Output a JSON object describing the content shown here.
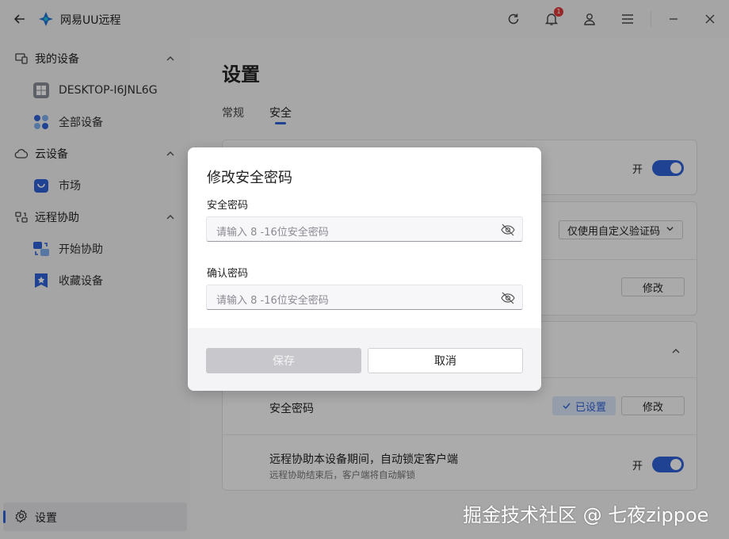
{
  "app": {
    "title": "网易UU远程",
    "notification_count": "1",
    "colors": {
      "accent": "#2e63d8",
      "badge": "#e23a3a"
    }
  },
  "titlebar_icons": [
    "back-icon",
    "refresh-icon",
    "bell-icon",
    "user-icon",
    "menu-icon",
    "minimize-icon",
    "close-icon"
  ],
  "sidebar": {
    "groups": [
      {
        "label": "我的设备",
        "icon": "devices-icon",
        "items": [
          {
            "label": "DESKTOP-I6JNL6G",
            "icon": "windows-icon"
          },
          {
            "label": "全部设备",
            "icon": "all-devices-icon"
          }
        ]
      },
      {
        "label": "云设备",
        "icon": "cloud-icon",
        "items": [
          {
            "label": "市场",
            "icon": "market-icon"
          }
        ]
      },
      {
        "label": "远程协助",
        "icon": "assist-icon",
        "items": [
          {
            "label": "开始协助",
            "icon": "start-assist-icon"
          },
          {
            "label": "收藏设备",
            "icon": "favorite-icon"
          }
        ]
      }
    ],
    "settings_label": "设置"
  },
  "main": {
    "title": "设置",
    "tabs": [
      {
        "label": "常规"
      },
      {
        "label": "安全",
        "active": true
      }
    ],
    "rows": {
      "toggle1": {
        "state_label": "开",
        "on": true
      },
      "verification": {
        "dropdown_value": "仅使用自定义验证码"
      },
      "modify1": {
        "button_label": "修改"
      },
      "security_password": {
        "label": "安全密码",
        "status": "已设置",
        "button_label": "修改"
      },
      "auto_lock": {
        "label": "远程协助本设备期间，自动锁定客户端",
        "sublabel": "远程协助结束后，客户端将自动解锁",
        "state_label": "开",
        "on": true
      }
    }
  },
  "modal": {
    "title": "修改安全密码",
    "fields": [
      {
        "label": "安全密码",
        "placeholder": "请输入 8 -16位安全密码"
      },
      {
        "label": "确认密码",
        "placeholder": "请输入 8 -16位安全密码"
      }
    ],
    "save_label": "保存",
    "cancel_label": "取消"
  },
  "watermark": "掘金技术社区 @ 七夜zippoe"
}
